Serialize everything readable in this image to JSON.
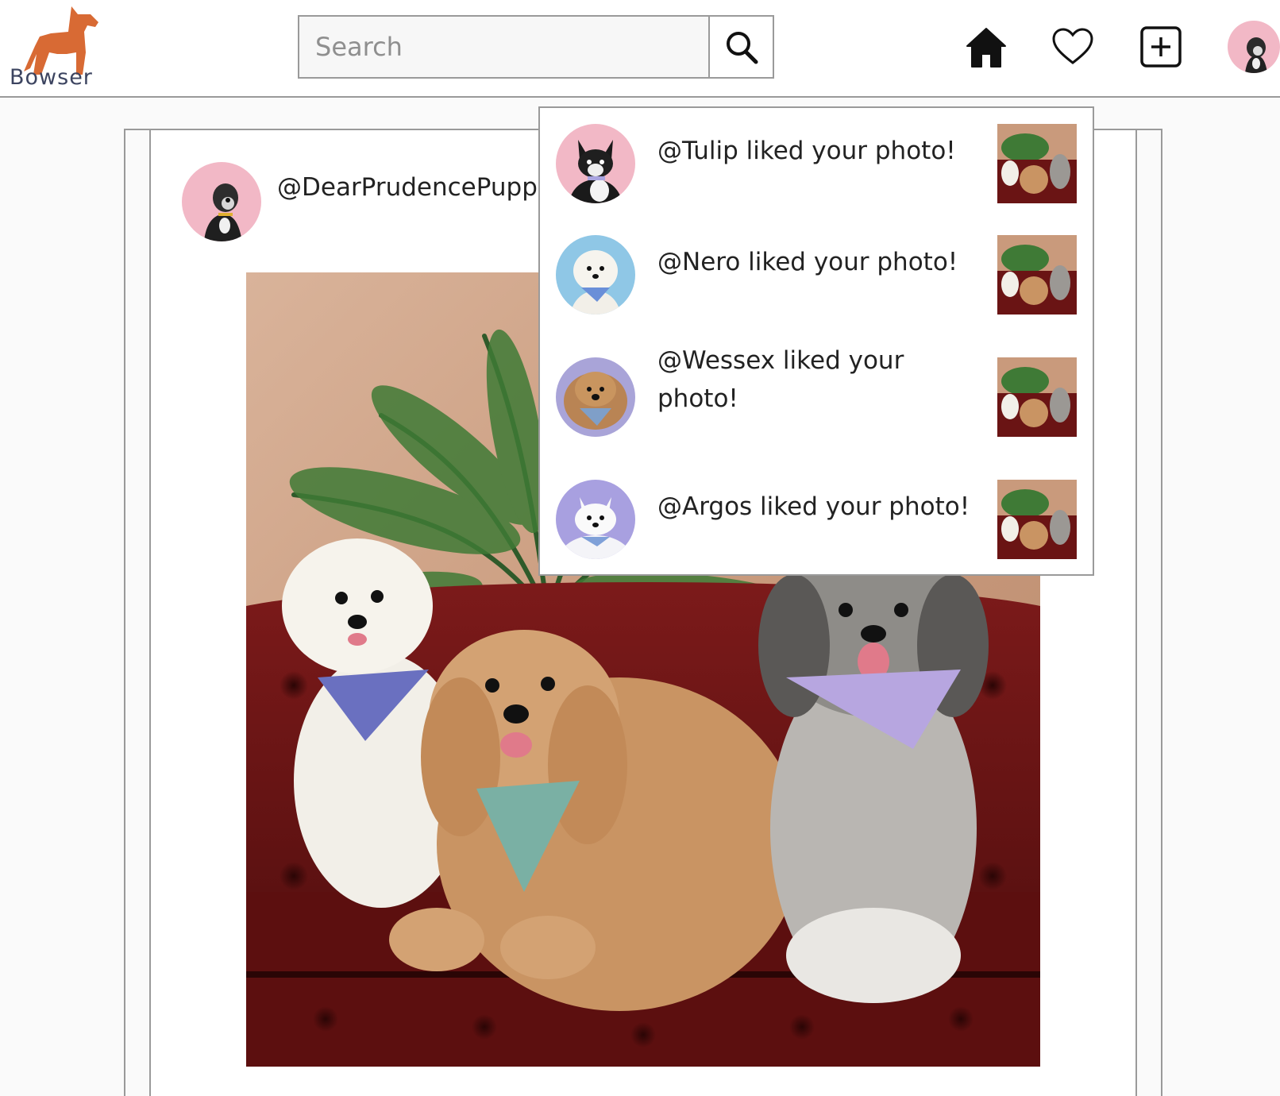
{
  "brand": {
    "name": "Bowser",
    "logo_color": "#d86a34",
    "text_color": "#3c4460"
  },
  "search": {
    "placeholder": "Search"
  },
  "nav": {
    "icons": [
      "home-icon",
      "heart-icon",
      "add-post-icon",
      "profile-avatar"
    ]
  },
  "post": {
    "username": "@DearPrudencePupp"
  },
  "notifications": [
    {
      "text": "@Tulip liked your photo!",
      "avatar_bg": "#f2b8c6"
    },
    {
      "text": "@Nero liked your photo!",
      "avatar_bg": "#8fc7e6"
    },
    {
      "text": "@Wessex liked your photo!",
      "avatar_bg": "#a9a4d8"
    },
    {
      "text": "@Argos liked your photo!",
      "avatar_bg": "#a8a0e0"
    }
  ],
  "colors": {
    "border": "#9a9a9a",
    "background": "#fafafa",
    "pink_avatar": "#f2b8c6"
  }
}
